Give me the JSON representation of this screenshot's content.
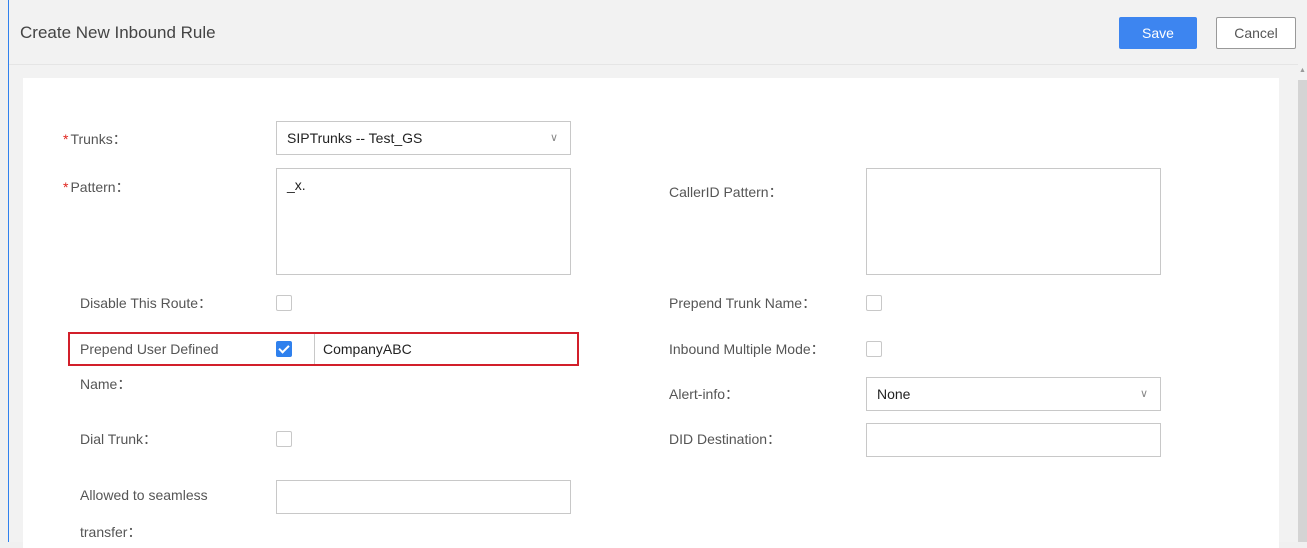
{
  "header": {
    "title": "Create New Inbound Rule",
    "save_label": "Save",
    "cancel_label": "Cancel"
  },
  "form": {
    "trunks": {
      "label": "Trunks：",
      "value": "SIPTrunks -- Test_GS",
      "required": true
    },
    "pattern": {
      "label": "Pattern：",
      "value": "_x.",
      "required": true
    },
    "callerid_pattern": {
      "label": "CallerID Pattern：",
      "value": ""
    },
    "disable_route": {
      "label": "Disable This Route：",
      "checked": false
    },
    "prepend_trunk_name": {
      "label": "Prepend Trunk Name：",
      "checked": false
    },
    "prepend_user_defined": {
      "label_line1": "Prepend User Defined",
      "label_line2": "Name：",
      "checked": true,
      "value": "CompanyABC"
    },
    "inbound_multiple_mode": {
      "label": "Inbound Multiple Mode：",
      "checked": false
    },
    "alert_info": {
      "label": "Alert-info：",
      "value": "None"
    },
    "dial_trunk": {
      "label": "Dial Trunk：",
      "checked": false
    },
    "did_destination": {
      "label": "DID Destination：",
      "value": ""
    },
    "seamless_transfer": {
      "label_line1": "Allowed to seamless",
      "label_line2": "transfer：",
      "value": ""
    }
  },
  "required_marker": "*",
  "colors": {
    "accent": "#3d85f0",
    "required": "#e0241d",
    "highlight_border": "#d21f2a"
  },
  "icons": {
    "dropdown": "chevron-down-icon",
    "checkbox_checked": "checkmark-icon"
  }
}
